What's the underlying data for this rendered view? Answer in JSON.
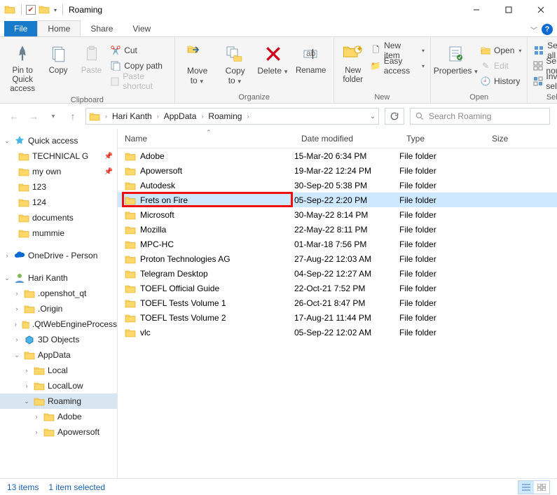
{
  "window": {
    "title": "Roaming"
  },
  "tabs": {
    "file": "File",
    "home": "Home",
    "share": "Share",
    "view": "View"
  },
  "ribbon": {
    "pin": "Pin to Quick access",
    "copy": "Copy",
    "paste": "Paste",
    "cut": "Cut",
    "copypath": "Copy path",
    "pasteshortcut": "Paste shortcut",
    "clipboard_label": "Clipboard",
    "moveto": "Move to",
    "copyto": "Copy to",
    "delete": "Delete",
    "rename": "Rename",
    "organize_label": "Organize",
    "newfolder": "New folder",
    "newitem": "New item",
    "easyaccess": "Easy access",
    "new_label": "New",
    "properties": "Properties",
    "open": "Open",
    "edit": "Edit",
    "history": "History",
    "open_label": "Open",
    "selectall": "Select all",
    "selectnone": "Select none",
    "invert": "Invert selection",
    "select_label": "Select"
  },
  "breadcrumb": {
    "items": [
      "Hari Kanth",
      "AppData",
      "Roaming"
    ]
  },
  "search": {
    "placeholder": "Search Roaming"
  },
  "columns": {
    "name": "Name",
    "date": "Date modified",
    "type": "Type",
    "size": "Size"
  },
  "navpane": {
    "quickaccess": "Quick access",
    "qa_items": [
      {
        "label": "TECHNICAL G",
        "pin": true
      },
      {
        "label": "my own",
        "pin": true
      },
      {
        "label": "123",
        "pin": false
      },
      {
        "label": "124",
        "pin": false
      },
      {
        "label": "documents",
        "pin": false
      },
      {
        "label": "mummie",
        "pin": false
      }
    ],
    "onedrive": "OneDrive - Person",
    "user": "Hari Kanth",
    "user_items": [
      ".openshot_qt",
      ".Origin",
      ".QtWebEngineProcess",
      "3D Objects",
      "AppData"
    ],
    "appdata_items": [
      "Local",
      "LocalLow",
      "Roaming"
    ],
    "roaming_items": [
      "Adobe",
      "Apowersoft"
    ]
  },
  "rows": [
    {
      "name": "Adobe",
      "date": "15-Mar-20 6:34 PM",
      "type": "File folder"
    },
    {
      "name": "Apowersoft",
      "date": "19-Mar-22 12:24 PM",
      "type": "File folder"
    },
    {
      "name": "Autodesk",
      "date": "30-Sep-20 5:38 PM",
      "type": "File folder"
    },
    {
      "name": "Frets on Fire",
      "date": "05-Sep-22 2:20 PM",
      "type": "File folder",
      "selected": true,
      "highlight": true
    },
    {
      "name": "Microsoft",
      "date": "30-May-22 8:14 PM",
      "type": "File folder"
    },
    {
      "name": "Mozilla",
      "date": "22-May-22 8:11 PM",
      "type": "File folder"
    },
    {
      "name": "MPC-HC",
      "date": "01-Mar-18 7:56 PM",
      "type": "File folder"
    },
    {
      "name": "Proton Technologies AG",
      "date": "27-Aug-22 12:03 AM",
      "type": "File folder"
    },
    {
      "name": "Telegram Desktop",
      "date": "04-Sep-22 12:27 AM",
      "type": "File folder"
    },
    {
      "name": "TOEFL Official Guide",
      "date": "22-Oct-21 7:52 PM",
      "type": "File folder"
    },
    {
      "name": "TOEFL Tests Volume 1",
      "date": "26-Oct-21 8:47 PM",
      "type": "File folder"
    },
    {
      "name": "TOEFL Tests Volume 2",
      "date": "17-Aug-21 11:44 PM",
      "type": "File folder"
    },
    {
      "name": "vlc",
      "date": "05-Sep-22 12:02 AM",
      "type": "File folder"
    }
  ],
  "status": {
    "count": "13 items",
    "selected": "1 item selected"
  }
}
